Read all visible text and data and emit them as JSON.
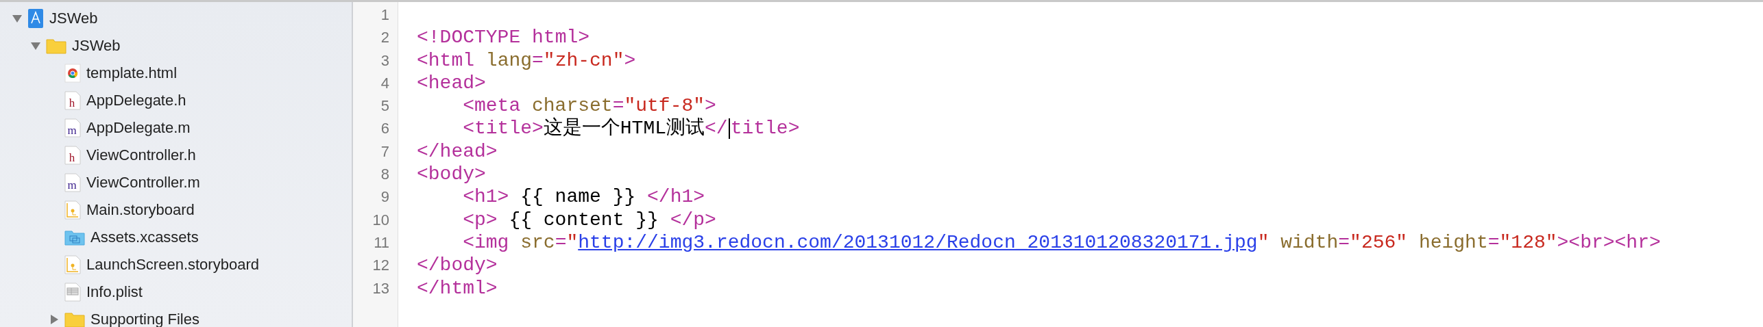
{
  "navigator": {
    "items": [
      {
        "label": "JSWeb",
        "kind": "project",
        "expanded": true,
        "children": [
          {
            "label": "JSWeb",
            "kind": "folder",
            "expanded": true,
            "children": [
              {
                "label": "template.html",
                "kind": "html"
              },
              {
                "label": "AppDelegate.h",
                "kind": "header",
                "icon_letter": "h"
              },
              {
                "label": "AppDelegate.m",
                "kind": "source",
                "icon_letter": "m"
              },
              {
                "label": "ViewController.h",
                "kind": "header",
                "icon_letter": "h"
              },
              {
                "label": "ViewController.m",
                "kind": "source",
                "icon_letter": "m"
              },
              {
                "label": "Main.storyboard",
                "kind": "storyboard"
              },
              {
                "label": "Assets.xcassets",
                "kind": "assets"
              },
              {
                "label": "LaunchScreen.storyboard",
                "kind": "storyboard"
              },
              {
                "label": "Info.plist",
                "kind": "plist"
              },
              {
                "label": "Supporting Files",
                "kind": "folder",
                "expanded": false
              }
            ]
          }
        ]
      }
    ]
  },
  "editor": {
    "lines": [
      {
        "number": "1"
      },
      {
        "number": "2",
        "indented": false,
        "tokens": [
          {
            "kind": "tag",
            "text": "<!DOCTYPE html>"
          }
        ]
      },
      {
        "number": "3",
        "indented": false,
        "tokens": [
          {
            "kind": "tag",
            "text": "<html "
          },
          {
            "kind": "attr",
            "text": "lang"
          },
          {
            "kind": "tag",
            "text": "="
          },
          {
            "kind": "string",
            "text": "\"zh-cn\""
          },
          {
            "kind": "tag",
            "text": ">"
          }
        ]
      },
      {
        "number": "4",
        "indented": false,
        "tokens": [
          {
            "kind": "tag",
            "text": "<head>"
          }
        ]
      },
      {
        "number": "5",
        "indented": true,
        "tokens": [
          {
            "kind": "tag",
            "text": "<meta "
          },
          {
            "kind": "attr",
            "text": "charset"
          },
          {
            "kind": "tag",
            "text": "="
          },
          {
            "kind": "string",
            "text": "\"utf-8\""
          },
          {
            "kind": "tag",
            "text": ">"
          }
        ]
      },
      {
        "number": "6",
        "indented": true,
        "tokens": [
          {
            "kind": "tag",
            "text": "<title>"
          },
          {
            "kind": "text",
            "text": "这是一个HTML测试"
          },
          {
            "kind": "tag",
            "text": "</",
            "caret": true
          },
          {
            "kind": "tag",
            "text": "title>",
            "caret": false
          }
        ]
      },
      {
        "number": "7",
        "indented": false,
        "tokens": [
          {
            "kind": "tag",
            "text": "</head>"
          }
        ]
      },
      {
        "number": "8",
        "indented": false,
        "tokens": [
          {
            "kind": "tag",
            "text": "<body>"
          }
        ]
      },
      {
        "number": "9",
        "indented": true,
        "tokens": [
          {
            "kind": "tag",
            "text": "<h1>"
          },
          {
            "kind": "text",
            "text": " {{ name }} "
          },
          {
            "kind": "tag",
            "text": "</h1>"
          }
        ]
      },
      {
        "number": "10",
        "indented": true,
        "tokens": [
          {
            "kind": "tag",
            "text": "<p>"
          },
          {
            "kind": "text",
            "text": " {{ content }} "
          },
          {
            "kind": "tag",
            "text": "</p>"
          }
        ]
      },
      {
        "number": "11",
        "indented": true,
        "tokens": [
          {
            "kind": "tag",
            "text": "<img "
          },
          {
            "kind": "attr",
            "text": "src"
          },
          {
            "kind": "tag",
            "text": "="
          },
          {
            "kind": "string",
            "text": "\""
          },
          {
            "kind": "link",
            "text": "http://img3.redocn.com/20131012/Redocn_2013101208320171.jpg"
          },
          {
            "kind": "string",
            "text": "\""
          },
          {
            "kind": "attr",
            "text": " width"
          },
          {
            "kind": "tag",
            "text": "="
          },
          {
            "kind": "string",
            "text": "\"256\""
          },
          {
            "kind": "attr",
            "text": " height"
          },
          {
            "kind": "tag",
            "text": "="
          },
          {
            "kind": "string",
            "text": "\"128\""
          },
          {
            "kind": "tag",
            "text": "><br><hr>"
          }
        ]
      },
      {
        "number": "12",
        "indented": false,
        "tokens": [
          {
            "kind": "tag",
            "text": "</body>"
          }
        ]
      },
      {
        "number": "13",
        "indented": false,
        "tokens": [
          {
            "kind": "tag",
            "text": "</html>"
          }
        ]
      }
    ]
  }
}
